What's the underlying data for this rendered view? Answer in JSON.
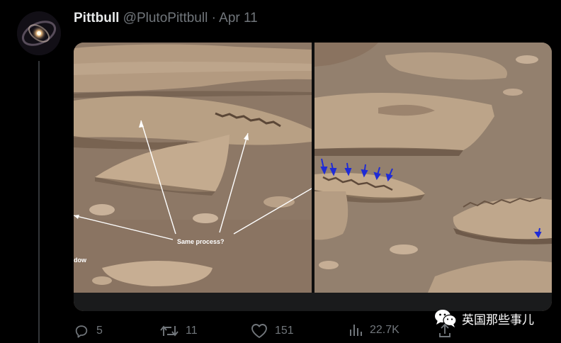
{
  "tweet": {
    "author_name": "Pittbull",
    "author_handle": "@PlutoPittbull",
    "separator": "·",
    "date": "Apr 11"
  },
  "media": {
    "annotation_label": "Same process?",
    "edge_label": "dow"
  },
  "actions": {
    "replies": "5",
    "retweets": "11",
    "likes": "151",
    "views": "22.7K"
  },
  "watermark": {
    "text": "英国那些事儿"
  },
  "colors": {
    "background": "#000000",
    "text_primary": "#e7e9ea",
    "text_secondary": "#71767b",
    "annotation_arrow": "#ffffff",
    "marker_arrow": "#1f2bd6"
  }
}
